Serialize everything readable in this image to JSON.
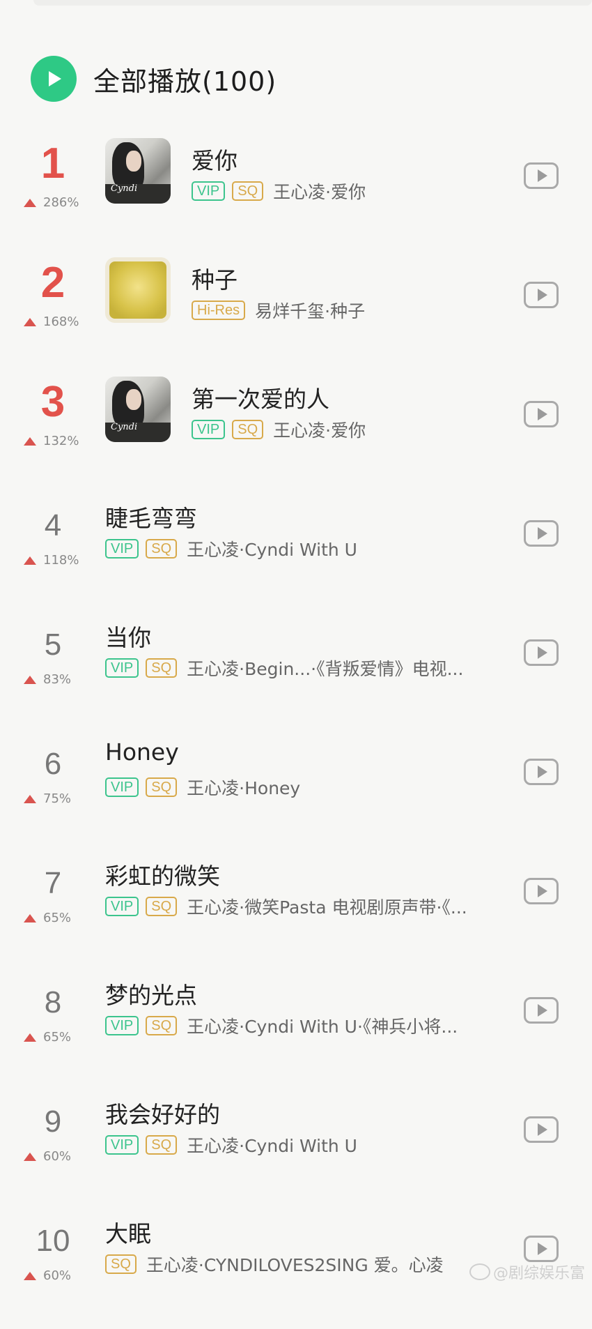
{
  "header": {
    "play_all_label": "全部播放(100)"
  },
  "songs": [
    {
      "rank": "1",
      "trend": "286%",
      "title": "爱你",
      "badges": [
        "VIP",
        "SQ"
      ],
      "meta": "王心凌·爱你",
      "cover": "cyndi-photo"
    },
    {
      "rank": "2",
      "trend": "168%",
      "title": "种子",
      "badges": [
        "Hi-Res"
      ],
      "meta": "易烊千玺·种子",
      "cover": "gold-seed"
    },
    {
      "rank": "3",
      "trend": "132%",
      "title": "第一次爱的人",
      "badges": [
        "VIP",
        "SQ"
      ],
      "meta": "王心凌·爱你",
      "cover": "cyndi-photo"
    },
    {
      "rank": "4",
      "trend": "118%",
      "title": "睫毛弯弯",
      "badges": [
        "VIP",
        "SQ"
      ],
      "meta": "王心凌·Cyndi With U"
    },
    {
      "rank": "5",
      "trend": "83%",
      "title": "当你",
      "badges": [
        "VIP",
        "SQ"
      ],
      "meta": "王心凌·Begin...·《背叛爱情》电视..."
    },
    {
      "rank": "6",
      "trend": "75%",
      "title": "Honey",
      "badges": [
        "VIP",
        "SQ"
      ],
      "meta": "王心凌·Honey"
    },
    {
      "rank": "7",
      "trend": "65%",
      "title": "彩虹的微笑",
      "badges": [
        "VIP",
        "SQ"
      ],
      "meta": "王心凌·微笑Pasta 电视剧原声带·《..."
    },
    {
      "rank": "8",
      "trend": "65%",
      "title": "梦的光点",
      "badges": [
        "VIP",
        "SQ"
      ],
      "meta": "王心凌·Cyndi With U·《神兵小将..."
    },
    {
      "rank": "9",
      "trend": "60%",
      "title": "我会好好的",
      "badges": [
        "VIP",
        "SQ"
      ],
      "meta": "王心凌·Cyndi With U"
    },
    {
      "rank": "10",
      "trend": "60%",
      "title": "大眠",
      "badges": [
        "SQ"
      ],
      "meta": "王心凌·CYNDILOVES2SING 爱。心凌"
    }
  ],
  "cover_logo": "Cyndi",
  "watermark": "@剧综娱乐富",
  "colors": {
    "accent_green": "#2ec985",
    "rank_red": "#e2524b",
    "vip_green": "#3cc48d",
    "sq_gold": "#d8a94a"
  },
  "icons": {
    "play_all": "play-circle-icon",
    "row_play": "play-square-icon",
    "trend": "triangle-up-icon"
  }
}
